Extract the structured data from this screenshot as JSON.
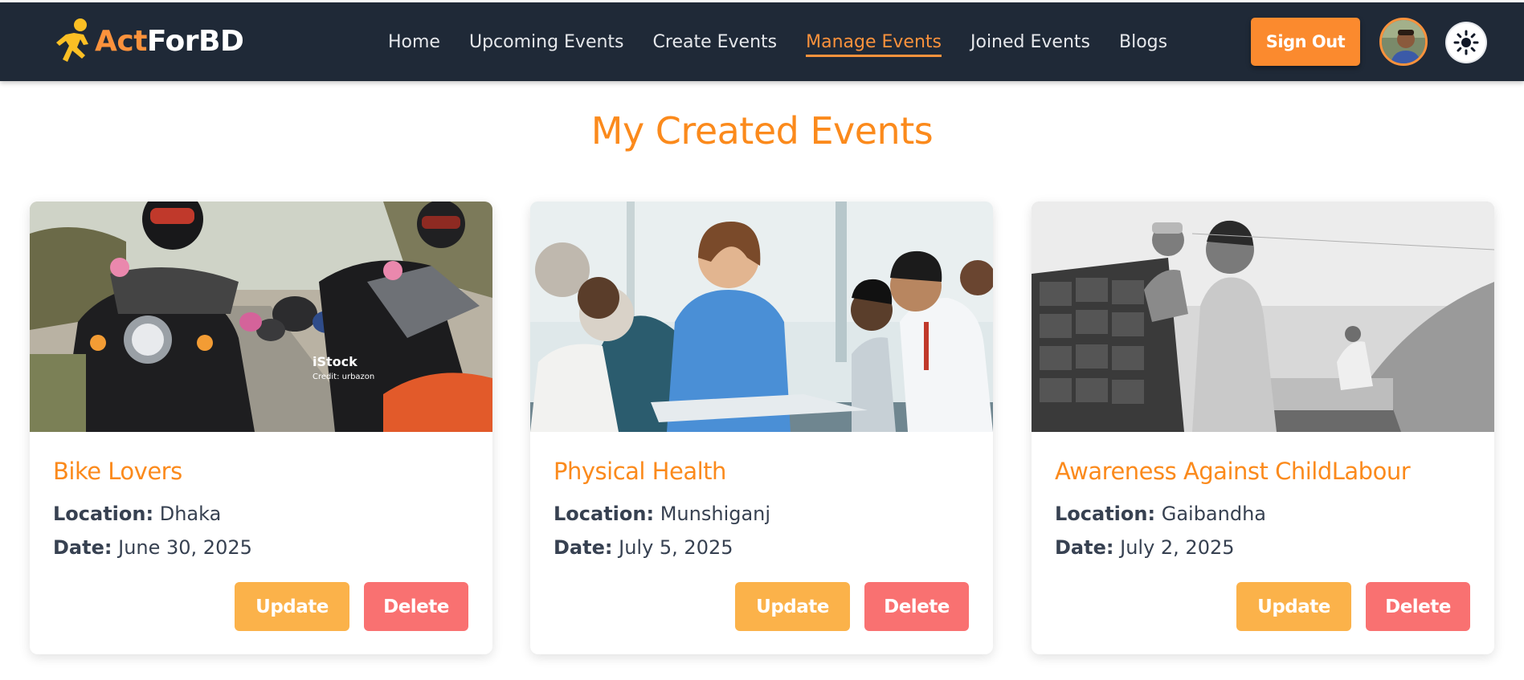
{
  "brand": {
    "part1": "Act",
    "part2": "ForBD"
  },
  "nav": {
    "links": [
      {
        "label": "Home"
      },
      {
        "label": "Upcoming Events"
      },
      {
        "label": "Create Events"
      },
      {
        "label": "Manage Events",
        "active": true
      },
      {
        "label": "Joined Events"
      },
      {
        "label": "Blogs"
      }
    ],
    "signout_label": "Sign Out",
    "avatar_icon": "user-avatar",
    "theme_icon": "sun-icon"
  },
  "page": {
    "title": "My Created Events"
  },
  "labels": {
    "location": "Location:",
    "date": "Date:",
    "update": "Update",
    "delete": "Delete"
  },
  "events": [
    {
      "title": "Bike Lovers",
      "location": "Dhaka",
      "date": "June 30, 2025",
      "image_caption": "iStock",
      "image_credit": "Credit: urbazon"
    },
    {
      "title": "Physical Health",
      "location": "Munshiganj",
      "date": "July 5, 2025"
    },
    {
      "title": "Awareness Against ChildLabour",
      "location": "Gaibandha",
      "date": "July 2, 2025"
    }
  ],
  "colors": {
    "accent": "#fb8a1c",
    "navbar": "#1f2937",
    "update": "#fbb24a",
    "delete": "#f97171"
  }
}
